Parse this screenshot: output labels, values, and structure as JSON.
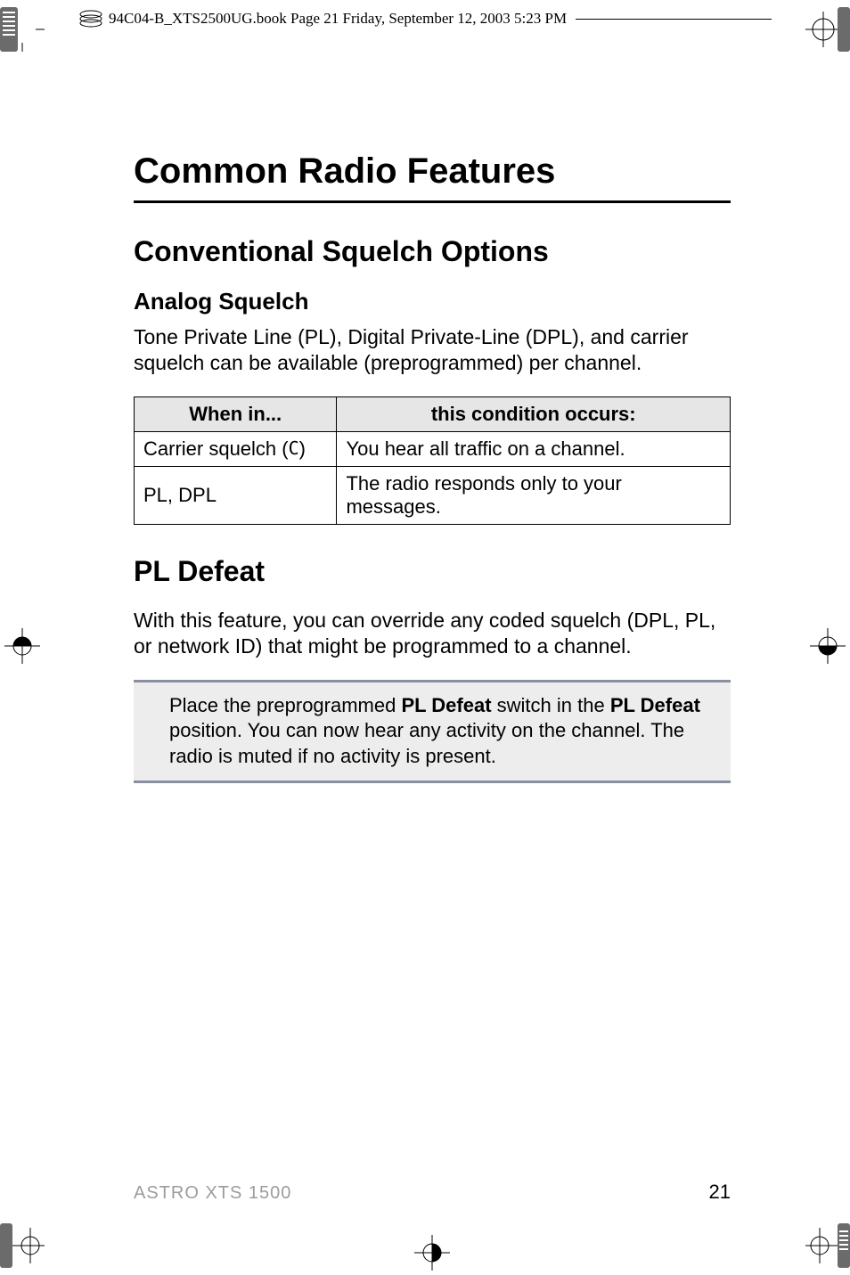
{
  "header": {
    "filename_line": "94C04-B_XTS2500UG.book  Page 21  Friday, September 12, 2003  5:23 PM"
  },
  "title": "Common Radio Features",
  "section1": {
    "heading": "Conventional Squelch Options",
    "sub1": {
      "heading": "Analog Squelch",
      "para": "Tone Private Line (PL), Digital Private-Line (DPL), and carrier squelch can be available (preprogrammed) per channel."
    },
    "table": {
      "col1": "When in...",
      "col2": "this condition occurs:",
      "rows": [
        {
          "c1_pre": "Carrier squelch (",
          "c1_icon": "C",
          "c1_post": ")",
          "c2": "You hear all traffic on a channel."
        },
        {
          "c1_pre": "PL, DPL",
          "c1_icon": "",
          "c1_post": "",
          "c2": "The radio responds only to your messages."
        }
      ]
    }
  },
  "section2": {
    "heading": "PL Defeat",
    "para": "With this feature, you can override any coded squelch (DPL, PL, or network ID) that might be programmed to a channel.",
    "callout_pre": "Place the preprogrammed ",
    "callout_b1": "PL Defeat",
    "callout_mid": " switch in the ",
    "callout_b2": "PL Defeat",
    "callout_post": " position. You can now hear any activity on the channel. The radio is muted if no activity is present."
  },
  "footer": {
    "product": "ASTRO XTS 1500",
    "page": "21"
  }
}
